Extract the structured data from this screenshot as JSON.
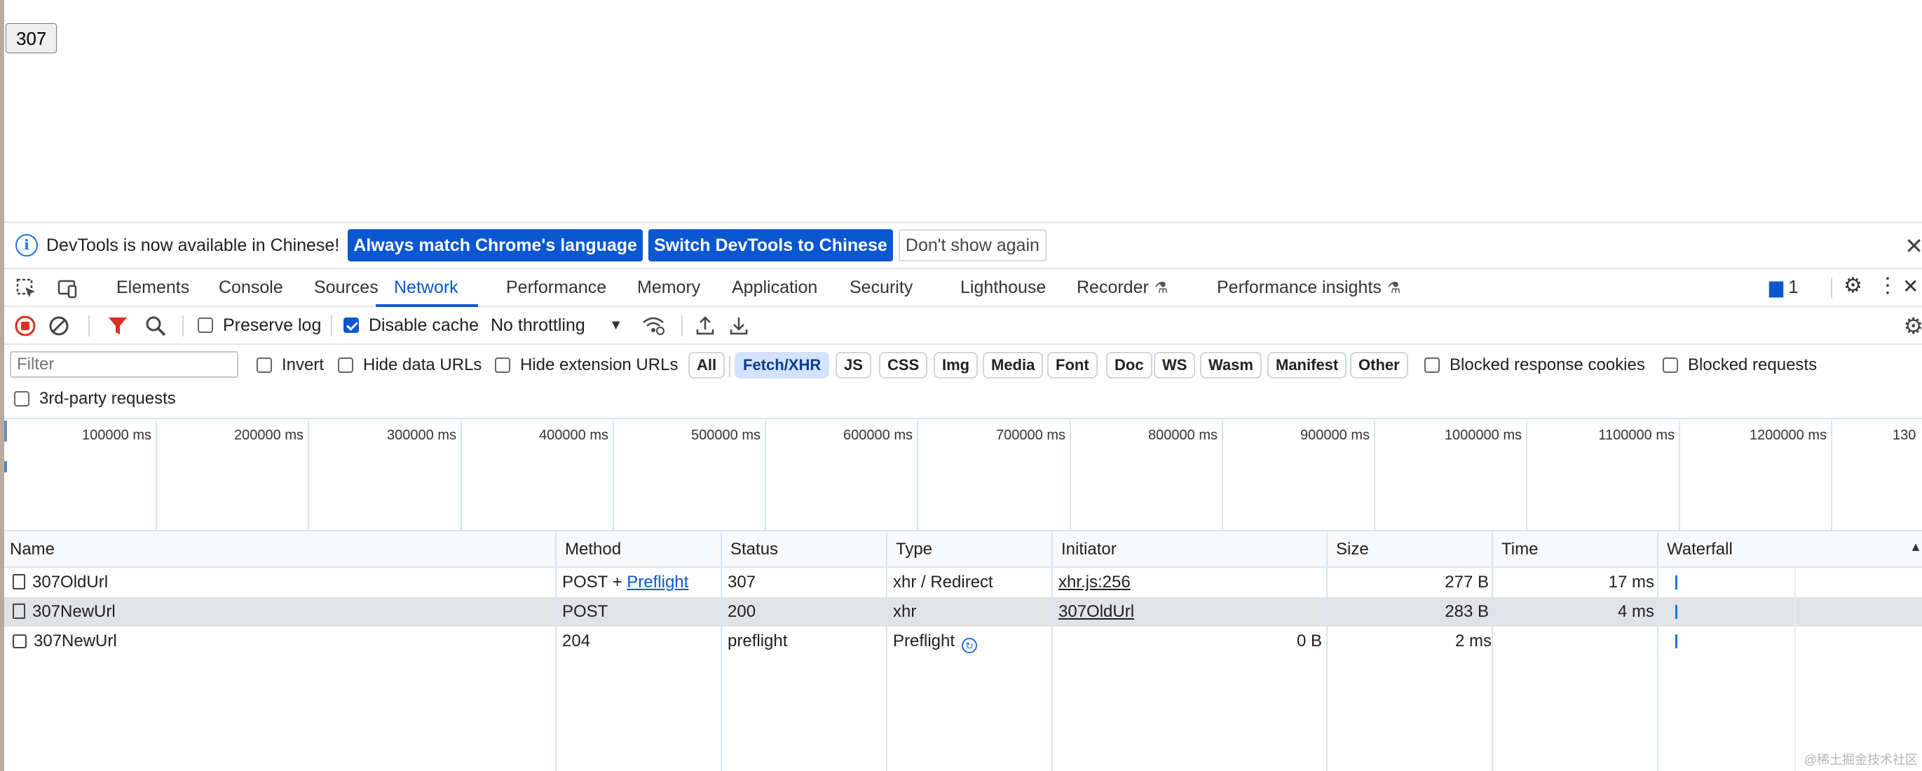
{
  "page": {
    "button_label": "307"
  },
  "infobar": {
    "message": "DevTools is now available in Chinese!",
    "btn_match": "Always match Chrome's language",
    "btn_switch": "Switch DevTools to Chinese",
    "btn_dismiss": "Don't show again"
  },
  "tabs": [
    "Elements",
    "Console",
    "Sources",
    "Network",
    "Performance",
    "Memory",
    "Application",
    "Security",
    "Lighthouse",
    "Recorder",
    "Performance insights"
  ],
  "issues_count": "1",
  "toolbar": {
    "preserve_log": "Preserve log",
    "disable_cache": "Disable cache",
    "throttling": "No throttling"
  },
  "filter": {
    "placeholder": "Filter",
    "invert": "Invert",
    "hide_data_urls": "Hide data URLs",
    "hide_extension_urls": "Hide extension URLs",
    "chips": [
      "All",
      "Fetch/XHR",
      "JS",
      "CSS",
      "Img",
      "Media",
      "Font",
      "Doc",
      "WS",
      "Wasm",
      "Manifest",
      "Other"
    ],
    "blocked_cookies": "Blocked response cookies",
    "blocked_requests": "Blocked requests",
    "third_party": "3rd-party requests"
  },
  "overview": {
    "ticks": [
      "100000 ms",
      "200000 ms",
      "300000 ms",
      "400000 ms",
      "500000 ms",
      "600000 ms",
      "700000 ms",
      "800000 ms",
      "900000 ms",
      "1000000 ms",
      "1100000 ms",
      "1200000 ms",
      "130"
    ]
  },
  "table": {
    "headers": [
      "Name",
      "Method",
      "Status",
      "Type",
      "Initiator",
      "Size",
      "Time",
      "Waterfall"
    ],
    "rows": [
      {
        "name": "307OldUrl",
        "method": "POST + ",
        "method_link": "Preflight",
        "status": "307",
        "type": "xhr / Redirect",
        "initiator": "xhr.js:256",
        "size": "277 B",
        "time": "17 ms"
      },
      {
        "name": "307NewUrl",
        "method": "POST",
        "status": "200",
        "type": "xhr",
        "initiator": "307OldUrl",
        "size": "283 B",
        "time": "4 ms"
      },
      {
        "name": "307NewUrl",
        "method": "204",
        "status": "preflight",
        "type": "Preflight",
        "initiator": "",
        "size": "0 B",
        "time": "2 ms"
      }
    ]
  },
  "watermark": "@稀土掘金技术社区"
}
